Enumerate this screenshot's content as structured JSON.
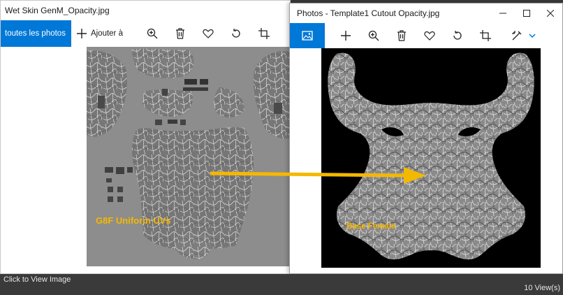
{
  "back_window": {
    "title": "Wet Skin GenM_Opacity.jpg",
    "nav_label": "toutes les photos",
    "add_label": "Ajouter à",
    "toolbar_icons": [
      "plus-icon",
      "zoom-in-icon",
      "delete-icon",
      "heart-icon",
      "rotate-icon",
      "crop-icon"
    ]
  },
  "front_window": {
    "title": "Photos - Template1 Cutout Opacity.jpg",
    "toolbar_icons": [
      "picture-icon",
      "plus-icon",
      "zoom-in-icon",
      "delete-icon",
      "heart-icon",
      "rotate-icon",
      "crop-icon",
      "edit-icon",
      "chevron-down-icon"
    ],
    "controls": [
      "minimize-icon",
      "maximize-icon",
      "close-icon"
    ]
  },
  "annotations": {
    "left_label": "G8F Uniform UVs",
    "right_label": "Base Female",
    "arrow_color": "#f5b800"
  },
  "status": {
    "left": "Click to View Image",
    "right": "10 View(s)"
  },
  "colors": {
    "accent": "#0078d7",
    "annotation": "#f5b800"
  }
}
